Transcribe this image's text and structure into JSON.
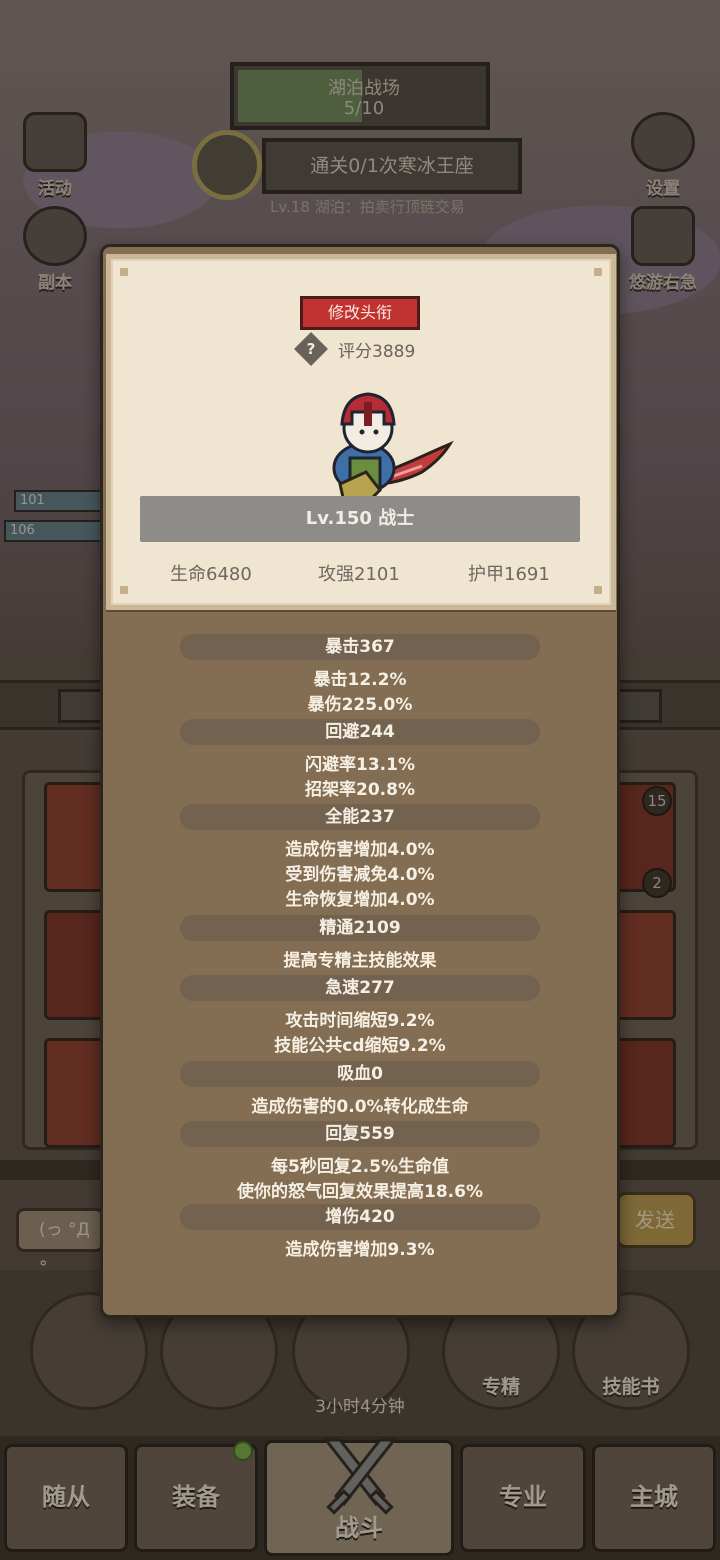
{
  "hud": {
    "battlefield_name": "湖泊战场",
    "battlefield_progress": "5/10",
    "quest": "通关0/1次寒冰王座",
    "sub_line": "Lv.18 湖泊：拍卖行顶链交易",
    "left_icons": [
      "活动",
      "副本"
    ],
    "right_icons": [
      "设置",
      "悠游右急"
    ],
    "unit_levels": [
      "101",
      "106"
    ]
  },
  "modal": {
    "change_title_button": "修改头衔",
    "score_label": "评分3889",
    "score_icon": "?",
    "level_class": "Lv.150 战士",
    "stats": {
      "hp": "生命6480",
      "attack": "攻强2101",
      "armor": "护甲1691"
    },
    "sections": [
      {
        "title": "暴击367",
        "lines": [
          "暴击12.2%",
          "暴伤225.0%"
        ]
      },
      {
        "title": "回避244",
        "lines": [
          "闪避率13.1%",
          "招架率20.8%"
        ]
      },
      {
        "title": "全能237",
        "lines": [
          "造成伤害增加4.0%",
          "受到伤害减免4.0%",
          "生命恢复增加4.0%"
        ]
      },
      {
        "title": "精通2109",
        "lines": [
          "提高专精主技能效果"
        ]
      },
      {
        "title": "急速277",
        "lines": [
          "攻击时间缩短9.2%",
          "技能公共cd缩短9.2%"
        ]
      },
      {
        "title": "吸血0",
        "lines": [
          "造成伤害的0.0%转化成生命"
        ]
      },
      {
        "title": "回复559",
        "lines": [
          "每5秒回复2.5%生命值",
          "使你的怒气回复效果提高18.6%"
        ]
      },
      {
        "title": "增伤420",
        "lines": [
          "造成伤害增加9.3%"
        ]
      }
    ]
  },
  "background": {
    "tile_badges": [
      "15",
      "2"
    ],
    "chat_placeholder": "(っ °Д °",
    "send_label": "发送",
    "circle_labels": [
      "专精",
      "技能书"
    ],
    "timer": "3小时4分钟"
  },
  "nav": {
    "items": [
      "随从",
      "装备",
      "战斗",
      "专业",
      "主城"
    ]
  },
  "colors": {
    "modal_brown": "#836d53",
    "card_parchment": "#efe5d1",
    "title_red": "#c03330",
    "level_bar": "#8e8c88"
  },
  "icons": [
    "question-diamond-icon",
    "warrior-avatar-icon",
    "crossed-swords-icon",
    "gear-icon"
  ]
}
